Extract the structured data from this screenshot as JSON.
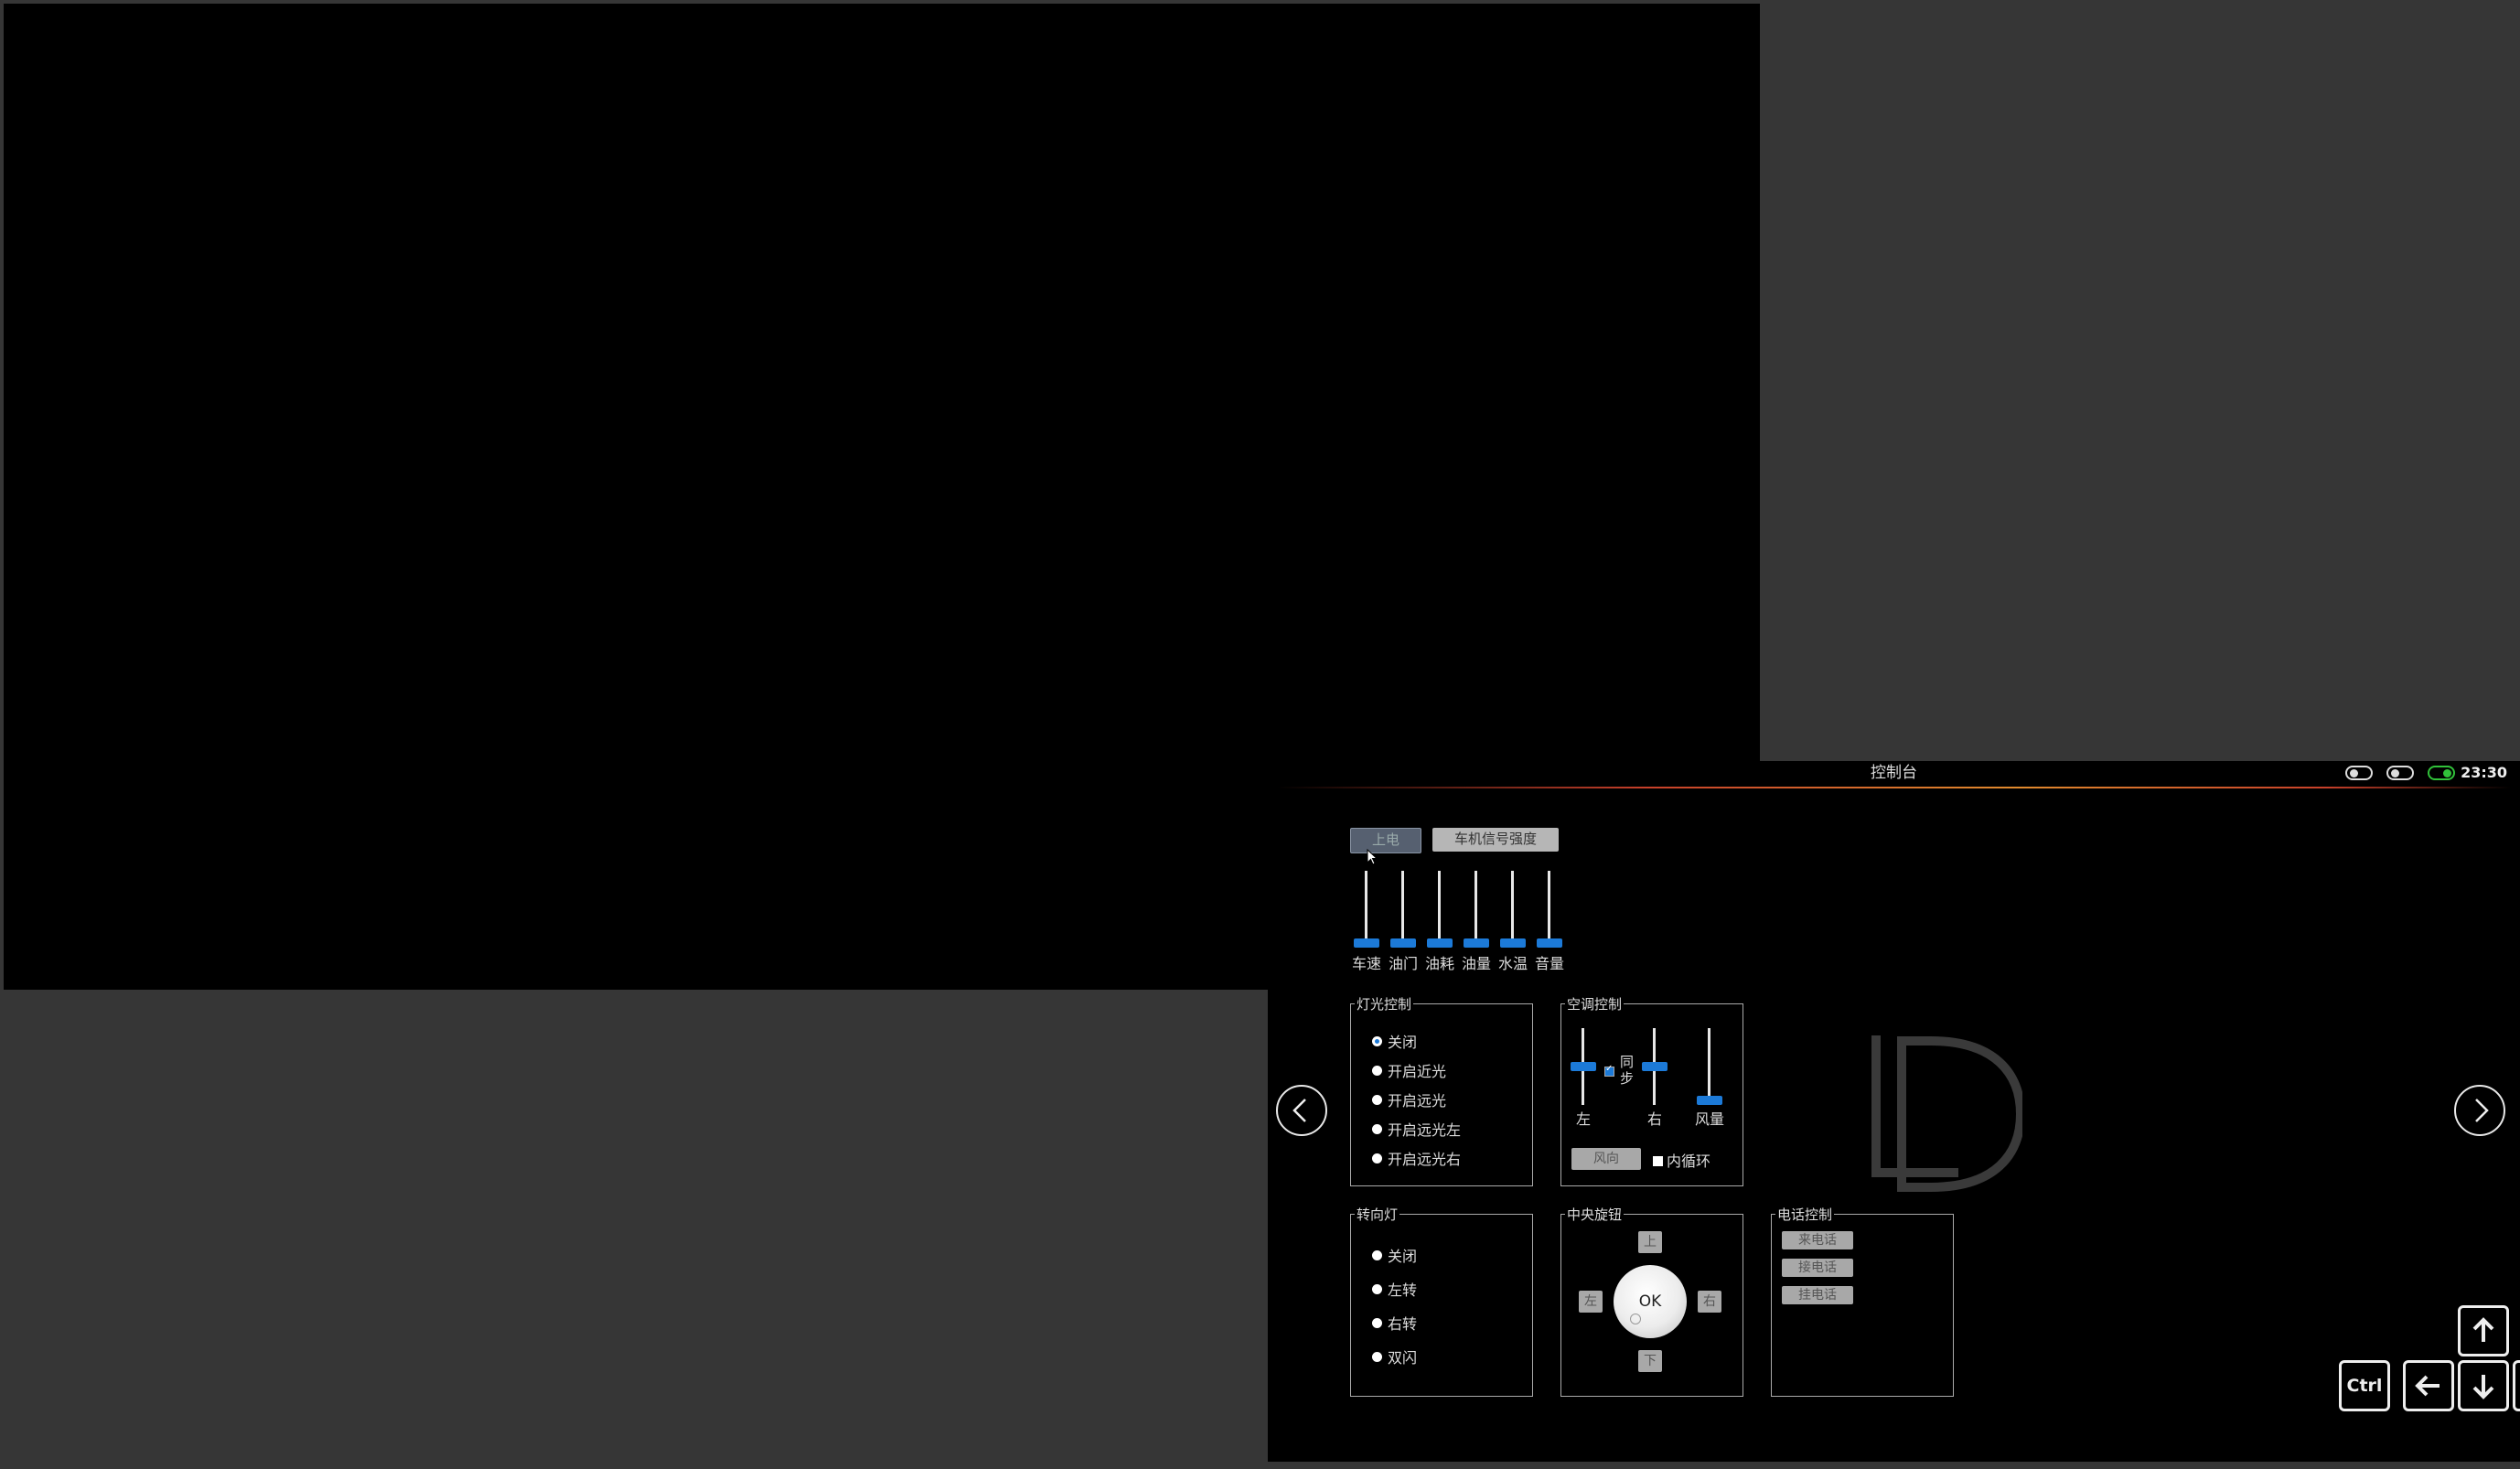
{
  "window": {
    "title": "控制台",
    "clock": "23:30",
    "toggles": [
      {
        "state": "off"
      },
      {
        "state": "off"
      },
      {
        "state": "on"
      }
    ]
  },
  "top_buttons": {
    "power_on": "上电",
    "signal_strength": "车机信号强度"
  },
  "gauges": [
    {
      "label": "车速",
      "value": 0
    },
    {
      "label": "油门",
      "value": 0
    },
    {
      "label": "油耗",
      "value": 0
    },
    {
      "label": "油量",
      "value": 0
    },
    {
      "label": "水温",
      "value": 0
    },
    {
      "label": "音量",
      "value": 0
    }
  ],
  "light_control": {
    "title": "灯光控制",
    "options": [
      "关闭",
      "开启近光",
      "开启远光",
      "开启远光左",
      "开启远光右"
    ],
    "selected": "关闭"
  },
  "ac_control": {
    "title": "空调控制",
    "left_label": "左",
    "right_label": "右",
    "fan_label": "风量",
    "sync_label": "同步",
    "sync_checked": true,
    "left_level": 0.5,
    "right_level": 0.5,
    "fan_level": 0,
    "wind_direction_button": "风向",
    "recirculation_label": "内循环",
    "recirculation_checked": false
  },
  "turn_signal": {
    "title": "转向灯",
    "options": [
      "关闭",
      "左转",
      "右转",
      "双闪"
    ],
    "selected": ""
  },
  "central_knob": {
    "title": "中央旋钮",
    "up": "上",
    "down": "下",
    "left": "左",
    "right": "右",
    "ok": "OK"
  },
  "phone_control": {
    "title": "电话控制",
    "buttons": [
      "来电话",
      "接电话",
      "挂电话"
    ]
  },
  "logo_text": "LD",
  "nav": {
    "prev_icon": "chevron-left-icon",
    "next_icon": "chevron-right-icon"
  },
  "keys": {
    "ctrl": "Ctrl"
  }
}
